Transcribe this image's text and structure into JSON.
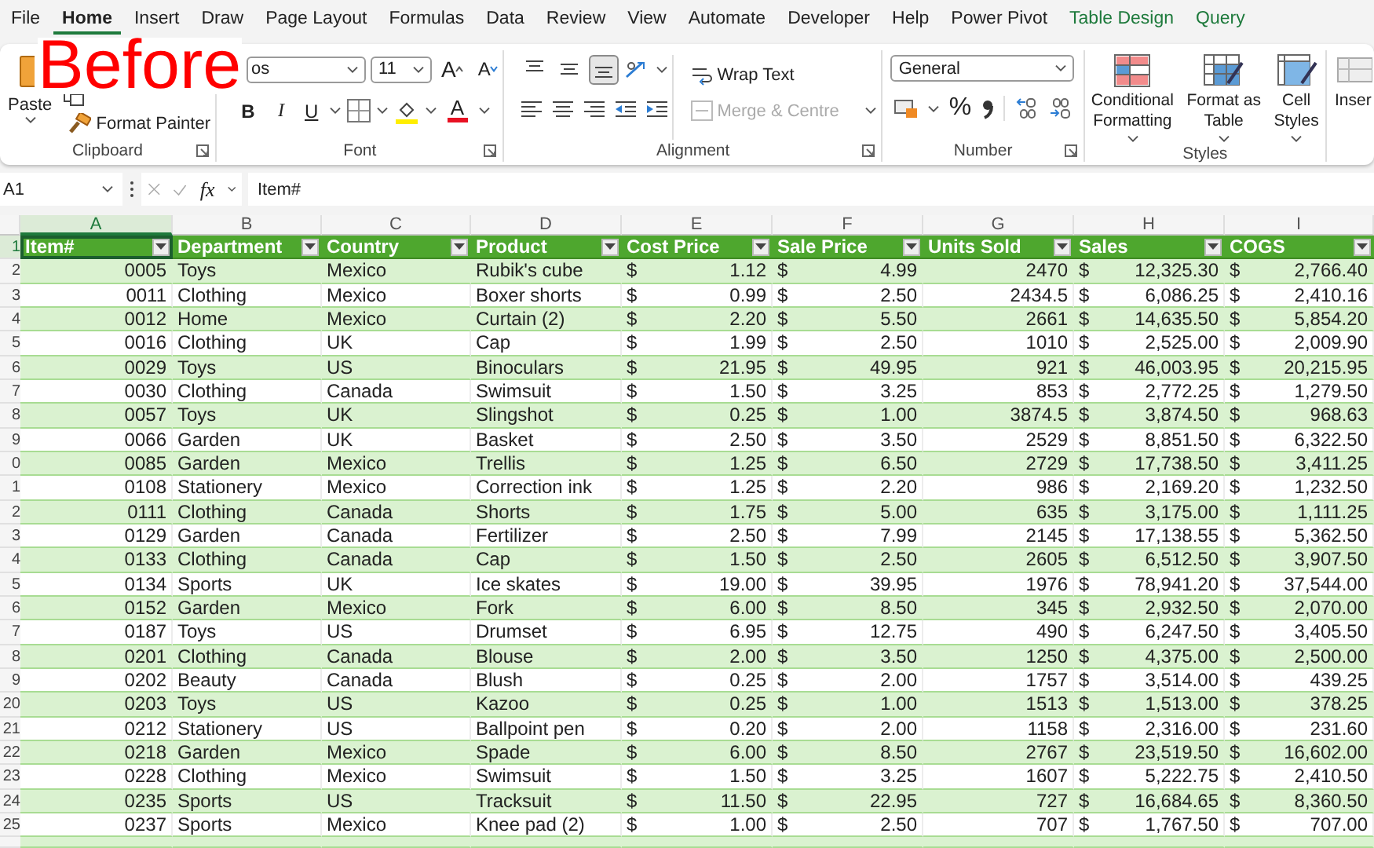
{
  "annotation": {
    "text": "Before"
  },
  "menu_tabs": [
    {
      "label": "File",
      "selected": false,
      "kind": "standard"
    },
    {
      "label": "Home",
      "selected": true,
      "kind": "standard"
    },
    {
      "label": "Insert",
      "selected": false,
      "kind": "standard"
    },
    {
      "label": "Draw",
      "selected": false,
      "kind": "standard"
    },
    {
      "label": "Page Layout",
      "selected": false,
      "kind": "standard"
    },
    {
      "label": "Formulas",
      "selected": false,
      "kind": "standard"
    },
    {
      "label": "Data",
      "selected": false,
      "kind": "standard"
    },
    {
      "label": "Review",
      "selected": false,
      "kind": "standard"
    },
    {
      "label": "View",
      "selected": false,
      "kind": "standard"
    },
    {
      "label": "Automate",
      "selected": false,
      "kind": "standard"
    },
    {
      "label": "Developer",
      "selected": false,
      "kind": "standard"
    },
    {
      "label": "Help",
      "selected": false,
      "kind": "standard"
    },
    {
      "label": "Power Pivot",
      "selected": false,
      "kind": "standard"
    },
    {
      "label": "Table Design",
      "selected": false,
      "kind": "contextual"
    },
    {
      "label": "Query",
      "selected": false,
      "kind": "contextual"
    }
  ],
  "ribbon": {
    "clipboard": {
      "paste": "Paste",
      "format_painter": "Format Painter",
      "group_label": "Clipboard"
    },
    "font": {
      "font_name": "os",
      "font_size": "11",
      "grow": "A",
      "shrink": "A",
      "bold": "B",
      "italic": "I",
      "underline": "U",
      "font_color": "A",
      "group_label": "Font"
    },
    "alignment": {
      "vertical_align": [
        {
          "selected": false
        },
        {
          "selected": false
        },
        {
          "selected": true
        }
      ],
      "wrap_text": "Wrap Text",
      "merge": {
        "label": "Merge & Centre",
        "disabled": true
      },
      "group_label": "Alignment"
    },
    "number": {
      "format": "General",
      "percent": "%",
      "group_label": "Number"
    },
    "styles": {
      "buttons": [
        {
          "lines": [
            "Conditional",
            "Formatting"
          ]
        },
        {
          "lines": [
            "Format as",
            "Table"
          ]
        },
        {
          "lines": [
            "Cell",
            "Styles"
          ]
        }
      ],
      "group_label": "Styles"
    },
    "insert": {
      "label": "Inser"
    }
  },
  "formula_bar": {
    "cell_ref": "A1",
    "fx": "fx",
    "formula": "Item#"
  },
  "sheet": {
    "columns": [
      {
        "letter": "A",
        "selected": true,
        "header": "Item#",
        "kind": "id"
      },
      {
        "letter": "B",
        "selected": false,
        "header": "Department",
        "kind": "text"
      },
      {
        "letter": "C",
        "selected": false,
        "header": "Country",
        "kind": "text"
      },
      {
        "letter": "D",
        "selected": false,
        "header": "Product",
        "kind": "text"
      },
      {
        "letter": "E",
        "selected": false,
        "header": "Cost Price",
        "kind": "currency"
      },
      {
        "letter": "F",
        "selected": false,
        "header": "Sale Price",
        "kind": "currency"
      },
      {
        "letter": "G",
        "selected": false,
        "header": "Units Sold",
        "kind": "number"
      },
      {
        "letter": "H",
        "selected": false,
        "header": "Sales",
        "kind": "currency"
      },
      {
        "letter": "I",
        "selected": false,
        "header": "COGS",
        "kind": "currency"
      }
    ],
    "header_row": {
      "number": "1",
      "selected": true
    },
    "rows": [
      {
        "number": "2",
        "selected": false,
        "cells": [
          "0005",
          "Toys",
          "Mexico",
          "Rubik's cube",
          [
            "$",
            "1.12"
          ],
          [
            "$",
            "4.99"
          ],
          "2470",
          [
            "$",
            "12,325.30"
          ],
          [
            "$",
            "2,766.40"
          ]
        ]
      },
      {
        "number": "3",
        "selected": false,
        "cells": [
          "0011",
          "Clothing",
          "Mexico",
          "Boxer shorts",
          [
            "$",
            "0.99"
          ],
          [
            "$",
            "2.50"
          ],
          "2434.5",
          [
            "$",
            "6,086.25"
          ],
          [
            "$",
            "2,410.16"
          ]
        ]
      },
      {
        "number": "4",
        "selected": false,
        "cells": [
          "0012",
          "Home",
          "Mexico",
          "Curtain (2)",
          [
            "$",
            "2.20"
          ],
          [
            "$",
            "5.50"
          ],
          "2661",
          [
            "$",
            "14,635.50"
          ],
          [
            "$",
            "5,854.20"
          ]
        ]
      },
      {
        "number": "5",
        "selected": false,
        "cells": [
          "0016",
          "Clothing",
          "UK",
          "Cap",
          [
            "$",
            "1.99"
          ],
          [
            "$",
            "2.50"
          ],
          "1010",
          [
            "$",
            "2,525.00"
          ],
          [
            "$",
            "2,009.90"
          ]
        ]
      },
      {
        "number": "6",
        "selected": false,
        "cells": [
          "0029",
          "Toys",
          "US",
          "Binoculars",
          [
            "$",
            "21.95"
          ],
          [
            "$",
            "49.95"
          ],
          "921",
          [
            "$",
            "46,003.95"
          ],
          [
            "$",
            "20,215.95"
          ]
        ]
      },
      {
        "number": "7",
        "selected": false,
        "cells": [
          "0030",
          "Clothing",
          "Canada",
          "Swimsuit",
          [
            "$",
            "1.50"
          ],
          [
            "$",
            "3.25"
          ],
          "853",
          [
            "$",
            "2,772.25"
          ],
          [
            "$",
            "1,279.50"
          ]
        ]
      },
      {
        "number": "8",
        "selected": false,
        "cells": [
          "0057",
          "Toys",
          "UK",
          "Slingshot",
          [
            "$",
            "0.25"
          ],
          [
            "$",
            "1.00"
          ],
          "3874.5",
          [
            "$",
            "3,874.50"
          ],
          [
            "$",
            "968.63"
          ]
        ]
      },
      {
        "number": "9",
        "selected": false,
        "cells": [
          "0066",
          "Garden",
          "UK",
          "Basket",
          [
            "$",
            "2.50"
          ],
          [
            "$",
            "3.50"
          ],
          "2529",
          [
            "$",
            "8,851.50"
          ],
          [
            "$",
            "6,322.50"
          ]
        ]
      },
      {
        "number": "0",
        "selected": false,
        "cells": [
          "0085",
          "Garden",
          "Mexico",
          "Trellis",
          [
            "$",
            "1.25"
          ],
          [
            "$",
            "6.50"
          ],
          "2729",
          [
            "$",
            "17,738.50"
          ],
          [
            "$",
            "3,411.25"
          ]
        ]
      },
      {
        "number": "1",
        "selected": false,
        "cells": [
          "0108",
          "Stationery",
          "Mexico",
          "Correction ink",
          [
            "$",
            "1.25"
          ],
          [
            "$",
            "2.20"
          ],
          "986",
          [
            "$",
            "2,169.20"
          ],
          [
            "$",
            "1,232.50"
          ]
        ]
      },
      {
        "number": "2",
        "selected": false,
        "cells": [
          "0111",
          "Clothing",
          "Canada",
          "Shorts",
          [
            "$",
            "1.75"
          ],
          [
            "$",
            "5.00"
          ],
          "635",
          [
            "$",
            "3,175.00"
          ],
          [
            "$",
            "1,111.25"
          ]
        ]
      },
      {
        "number": "3",
        "selected": false,
        "cells": [
          "0129",
          "Garden",
          "Canada",
          "Fertilizer",
          [
            "$",
            "2.50"
          ],
          [
            "$",
            "7.99"
          ],
          "2145",
          [
            "$",
            "17,138.55"
          ],
          [
            "$",
            "5,362.50"
          ]
        ]
      },
      {
        "number": "4",
        "selected": false,
        "cells": [
          "0133",
          "Clothing",
          "Canada",
          "Cap",
          [
            "$",
            "1.50"
          ],
          [
            "$",
            "2.50"
          ],
          "2605",
          [
            "$",
            "6,512.50"
          ],
          [
            "$",
            "3,907.50"
          ]
        ]
      },
      {
        "number": "5",
        "selected": false,
        "cells": [
          "0134",
          "Sports",
          "UK",
          "Ice skates",
          [
            "$",
            "19.00"
          ],
          [
            "$",
            "39.95"
          ],
          "1976",
          [
            "$",
            "78,941.20"
          ],
          [
            "$",
            "37,544.00"
          ]
        ]
      },
      {
        "number": "6",
        "selected": false,
        "cells": [
          "0152",
          "Garden",
          "Mexico",
          "Fork",
          [
            "$",
            "6.00"
          ],
          [
            "$",
            "8.50"
          ],
          "345",
          [
            "$",
            "2,932.50"
          ],
          [
            "$",
            "2,070.00"
          ]
        ]
      },
      {
        "number": "7",
        "selected": false,
        "cells": [
          "0187",
          "Toys",
          "US",
          "Drumset",
          [
            "$",
            "6.95"
          ],
          [
            "$",
            "12.75"
          ],
          "490",
          [
            "$",
            "6,247.50"
          ],
          [
            "$",
            "3,405.50"
          ]
        ]
      },
      {
        "number": "8",
        "selected": false,
        "cells": [
          "0201",
          "Clothing",
          "Canada",
          "Blouse",
          [
            "$",
            "2.00"
          ],
          [
            "$",
            "3.50"
          ],
          "1250",
          [
            "$",
            "4,375.00"
          ],
          [
            "$",
            "2,500.00"
          ]
        ]
      },
      {
        "number": "9",
        "selected": false,
        "cells": [
          "0202",
          "Beauty",
          "Canada",
          "Blush",
          [
            "$",
            "0.25"
          ],
          [
            "$",
            "2.00"
          ],
          "1757",
          [
            "$",
            "3,514.00"
          ],
          [
            "$",
            "439.25"
          ]
        ]
      },
      {
        "number": "20",
        "selected": false,
        "cells": [
          "0203",
          "Toys",
          "US",
          "Kazoo",
          [
            "$",
            "0.25"
          ],
          [
            "$",
            "1.00"
          ],
          "1513",
          [
            "$",
            "1,513.00"
          ],
          [
            "$",
            "378.25"
          ]
        ]
      },
      {
        "number": "21",
        "selected": false,
        "cells": [
          "0212",
          "Stationery",
          "US",
          "Ballpoint pen",
          [
            "$",
            "0.20"
          ],
          [
            "$",
            "2.00"
          ],
          "1158",
          [
            "$",
            "2,316.00"
          ],
          [
            "$",
            "231.60"
          ]
        ]
      },
      {
        "number": "22",
        "selected": false,
        "cells": [
          "0218",
          "Garden",
          "Mexico",
          "Spade",
          [
            "$",
            "6.00"
          ],
          [
            "$",
            "8.50"
          ],
          "2767",
          [
            "$",
            "23,519.50"
          ],
          [
            "$",
            "16,602.00"
          ]
        ]
      },
      {
        "number": "23",
        "selected": false,
        "cells": [
          "0228",
          "Clothing",
          "Mexico",
          "Swimsuit",
          [
            "$",
            "1.50"
          ],
          [
            "$",
            "3.25"
          ],
          "1607",
          [
            "$",
            "5,222.75"
          ],
          [
            "$",
            "2,410.50"
          ]
        ]
      },
      {
        "number": "24",
        "selected": false,
        "cells": [
          "0235",
          "Sports",
          "US",
          "Tracksuit",
          [
            "$",
            "11.50"
          ],
          [
            "$",
            "22.95"
          ],
          "727",
          [
            "$",
            "16,684.65"
          ],
          [
            "$",
            "8,360.50"
          ]
        ]
      },
      {
        "number": "25",
        "selected": false,
        "cells": [
          "0237",
          "Sports",
          "Mexico",
          "Knee pad (2)",
          [
            "$",
            "1.00"
          ],
          [
            "$",
            "2.50"
          ],
          "707",
          [
            "$",
            "1,767.50"
          ],
          [
            "$",
            "707.00"
          ]
        ]
      }
    ]
  }
}
